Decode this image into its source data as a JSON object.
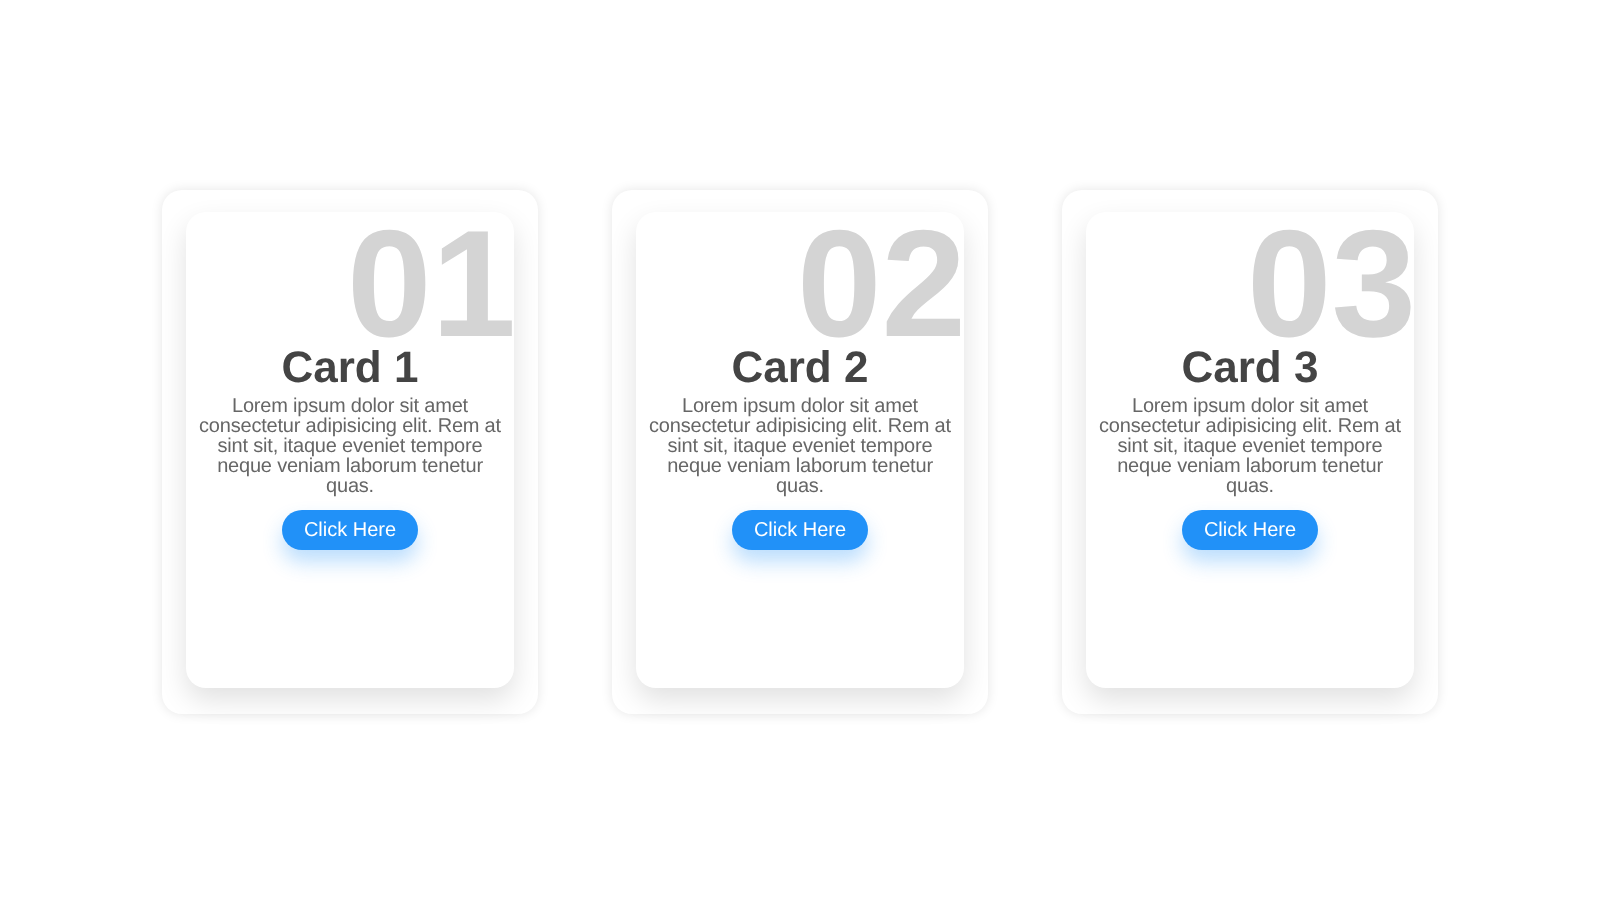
{
  "cards": [
    {
      "number": "01",
      "title": "Card 1",
      "text": "Lorem ipsum dolor sit amet consectetur adipisicing elit. Rem at sint sit, itaque eveniet tempore neque veniam laborum tenetur quas.",
      "button": "Click Here"
    },
    {
      "number": "02",
      "title": "Card 2",
      "text": "Lorem ipsum dolor sit amet consectetur adipisicing elit. Rem at sint sit, itaque eveniet tempore neque veniam laborum tenetur quas.",
      "button": "Click Here"
    },
    {
      "number": "03",
      "title": "Card 3",
      "text": "Lorem ipsum dolor sit amet consectetur adipisicing elit. Rem at sint sit, itaque eveniet tempore neque veniam laborum tenetur quas.",
      "button": "Click Here"
    }
  ]
}
